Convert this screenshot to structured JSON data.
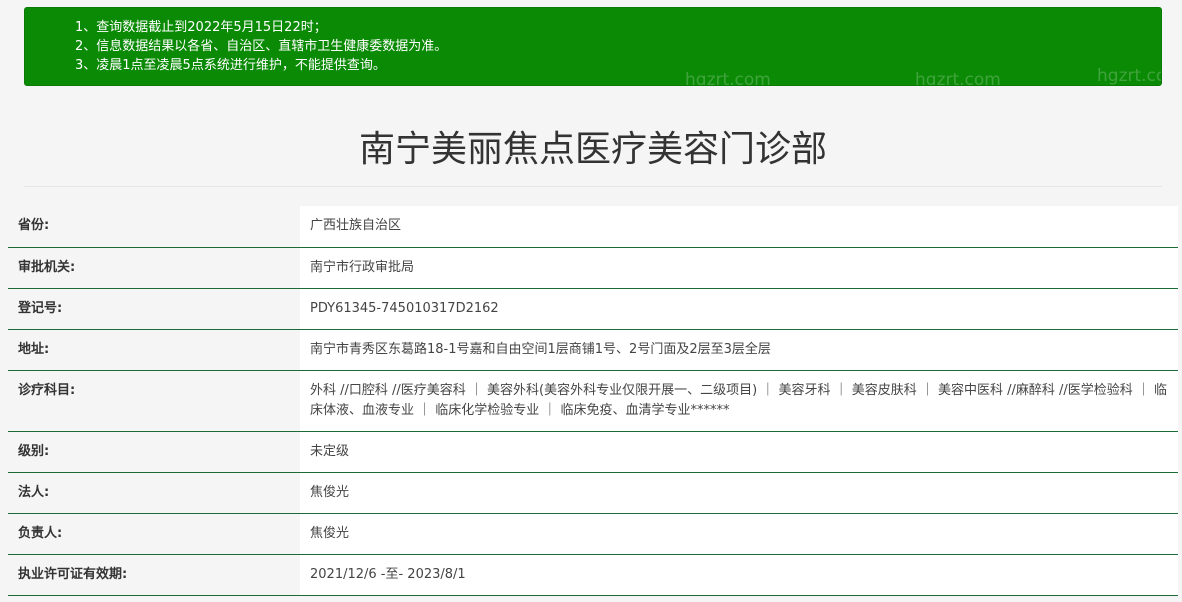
{
  "notice": {
    "lines": [
      "1、查询数据截止到2022年5月15日22时；",
      "2、信息数据结果以各省、自治区、直辖市卫生健康委数据为准。",
      "3、凌晨1点至凌晨5点系统进行维护，不能提供查询。"
    ],
    "watermark": "hgzrt.com"
  },
  "page_title": "南宁美丽焦点医疗美容门诊部",
  "rows": [
    {
      "label": "省份:",
      "value": "广西壮族自治区"
    },
    {
      "label": "审批机关:",
      "value": "南宁市行政审批局"
    },
    {
      "label": "登记号:",
      "value": "PDY61345-745010317D2162"
    },
    {
      "label": "地址:",
      "value": "南宁市青秀区东葛路18-1号嘉和自由空间1层商铺1号、2号门面及2层至3层全层"
    },
    {
      "label": "诊疗科目:",
      "value": "外科 //口腔科 //医疗美容科 ｜ 美容外科(美容外科专业仅限开展一、二级项目) ｜ 美容牙科 ｜ 美容皮肤科 ｜ 美容中医科 //麻醉科 //医学检验科 ｜ 临床体液、血液专业 ｜ 临床化学检验专业 ｜ 临床免疫、血清学专业******"
    },
    {
      "label": "级别:",
      "value": "未定级"
    },
    {
      "label": "法人:",
      "value": "焦俊光"
    },
    {
      "label": "负责人:",
      "value": "焦俊光"
    },
    {
      "label": "执业许可证有效期:",
      "value": "2021/12/6 -至- 2023/8/1"
    }
  ],
  "colors": {
    "notice_bg": "#0a8a05",
    "row_border": "#1b6b3a"
  }
}
